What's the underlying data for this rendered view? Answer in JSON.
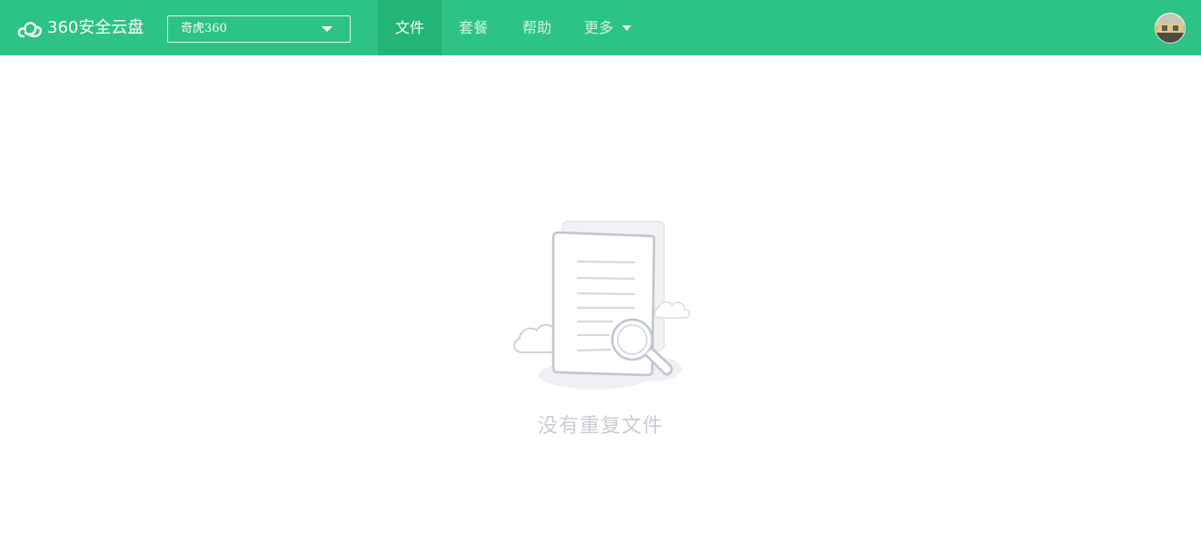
{
  "header": {
    "logo_text": "360安全云盘",
    "account": {
      "selected": "奇虎360"
    },
    "nav": [
      {
        "label": "文件",
        "active": true
      },
      {
        "label": "套餐",
        "active": false
      },
      {
        "label": "帮助",
        "active": false
      },
      {
        "label": "更多",
        "active": false
      }
    ]
  },
  "main": {
    "empty_message": "没有重复文件"
  },
  "colors": {
    "brand": "#2cc385",
    "nav_active": "#23b576",
    "empty_text": "#c9cdd4"
  },
  "icons": [
    "cloud-logo-icon",
    "chevron-down-icon",
    "avatar",
    "empty-document-search-icon"
  ]
}
